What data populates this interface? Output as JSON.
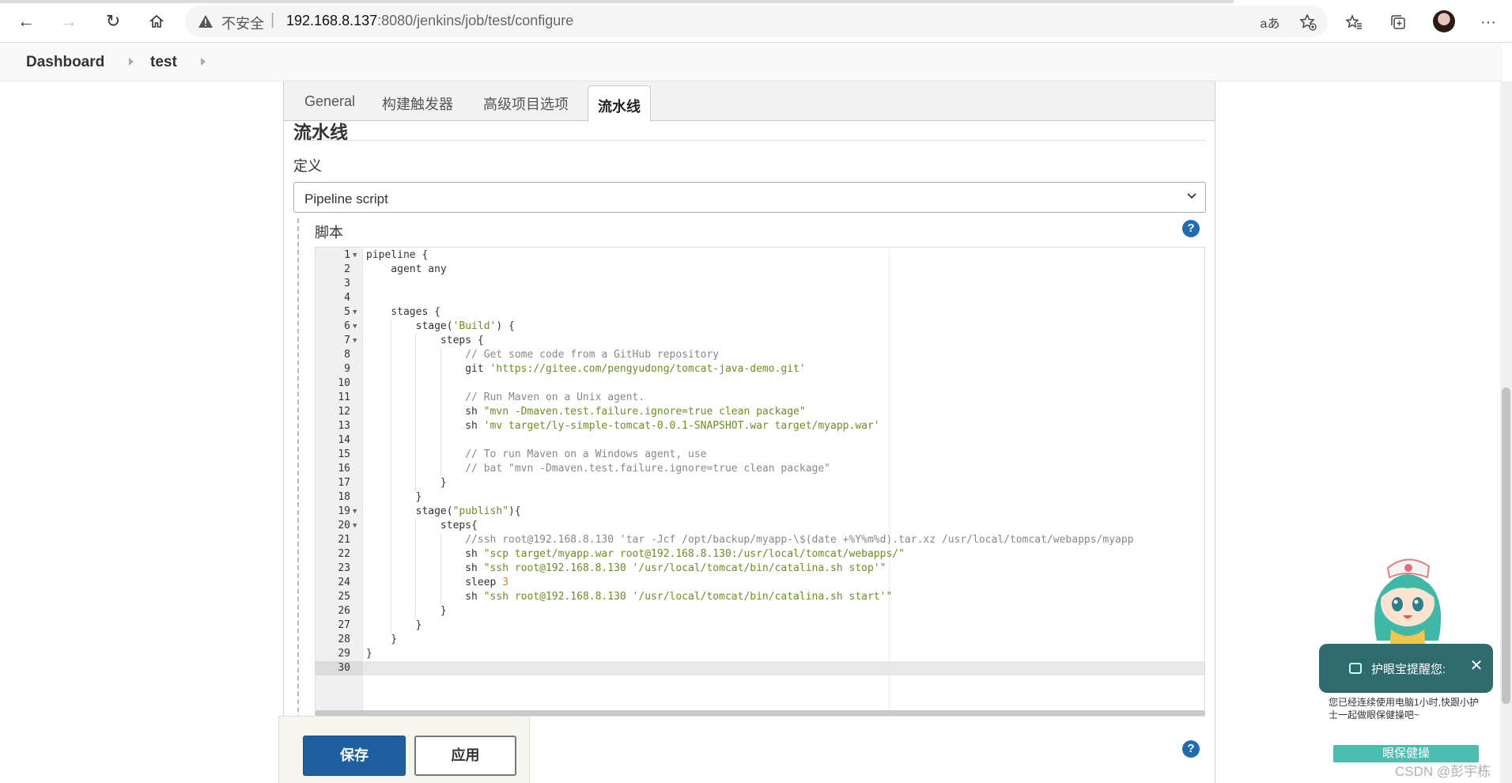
{
  "browser": {
    "address_insecure": "不安全",
    "url_host": "192.168.8.137",
    "url_rest": ":8080/jenkins/job/test/configure",
    "icons": [
      "back-icon",
      "forward-icon",
      "refresh-icon",
      "home-icon",
      "warning-icon",
      "read-aloud-icon",
      "add-favorite-icon",
      "favorites-icon",
      "collections-icon",
      "profile-avatar",
      "more-icon"
    ]
  },
  "breadcrumb": {
    "items": [
      "Dashboard",
      "test"
    ]
  },
  "tabs": [
    "General",
    "构建触发器",
    "高级项目选项",
    "流水线"
  ],
  "active_tab": "流水线",
  "section": {
    "title": "流水线",
    "definition_label": "定义",
    "definition_value": "Pipeline script",
    "script_label": "脚本",
    "help": "?"
  },
  "editor": {
    "lines": [
      {
        "n": "1",
        "fold": true,
        "code": "pipeline {"
      },
      {
        "n": "2",
        "code": "    agent any"
      },
      {
        "n": "3",
        "code": ""
      },
      {
        "n": "4",
        "code": ""
      },
      {
        "n": "5",
        "fold": true,
        "code": "    stages {"
      },
      {
        "n": "6",
        "fold": true,
        "code": "        stage(",
        "str": "'Build'",
        "after": ") {"
      },
      {
        "n": "7",
        "fold": true,
        "code": "            steps {"
      },
      {
        "n": "8",
        "comment": "                // Get some code from a GitHub repository"
      },
      {
        "n": "9",
        "code": "                git ",
        "str": "'https://gitee.com/pengyudong/tomcat-java-demo.git'"
      },
      {
        "n": "10",
        "code": ""
      },
      {
        "n": "11",
        "comment": "                // Run Maven on a Unix agent."
      },
      {
        "n": "12",
        "code": "                sh ",
        "str": "\"mvn -Dmaven.test.failure.ignore=true clean package\""
      },
      {
        "n": "13",
        "code": "                sh ",
        "str": "'mv target/ly-simple-tomcat-0.0.1-SNAPSHOT.war target/myapp.war'"
      },
      {
        "n": "14",
        "code": ""
      },
      {
        "n": "15",
        "comment": "                // To run Maven on a Windows agent, use"
      },
      {
        "n": "16",
        "comment": "                // bat \"mvn -Dmaven.test.failure.ignore=true clean package\""
      },
      {
        "n": "17",
        "code": "            }"
      },
      {
        "n": "18",
        "code": "        }"
      },
      {
        "n": "19",
        "fold": true,
        "code": "        stage(",
        "str": "\"publish\"",
        "after": "){"
      },
      {
        "n": "20",
        "fold": true,
        "code": "            steps{"
      },
      {
        "n": "21",
        "comment": "                //ssh root@192.168.8.130 'tar -Jcf /opt/backup/myapp-\\$(date +%Y%m%d).tar.xz /usr/local/tomcat/webapps/myapp"
      },
      {
        "n": "22",
        "code": "                sh ",
        "str": "\"scp target/myapp.war root@192.168.8.130:/usr/local/tomcat/webapps/\""
      },
      {
        "n": "23",
        "code": "                sh ",
        "str": "\"ssh root@192.168.8.130 '/usr/local/tomcat/bin/catalina.sh stop'\""
      },
      {
        "n": "24",
        "code": "                sleep ",
        "num": "3"
      },
      {
        "n": "25",
        "code": "                sh ",
        "str": "\"ssh root@192.168.8.130 '/usr/local/tomcat/bin/catalina.sh start'\""
      },
      {
        "n": "26",
        "code": "            }"
      },
      {
        "n": "27",
        "code": "        }"
      },
      {
        "n": "28",
        "code": "    }"
      },
      {
        "n": "29",
        "code": "}"
      },
      {
        "n": "30",
        "code": ""
      }
    ]
  },
  "buttons": {
    "save": "保存",
    "apply": "应用"
  },
  "eye_care": {
    "title": "护眼宝提醒您:",
    "body": "您已经连续使用电脑1小时,快跟小护士一起做眼保健操吧~",
    "button": "眼保健操",
    "close": "✕"
  },
  "watermark": "CSDN @彭宇栋",
  "colors": {
    "primary": "#1d5fa0",
    "string": "#6b8e23",
    "comment": "#888888",
    "number": "#e67e22",
    "popup": "#2e6a6e",
    "popup_button": "#4cbeb1"
  }
}
